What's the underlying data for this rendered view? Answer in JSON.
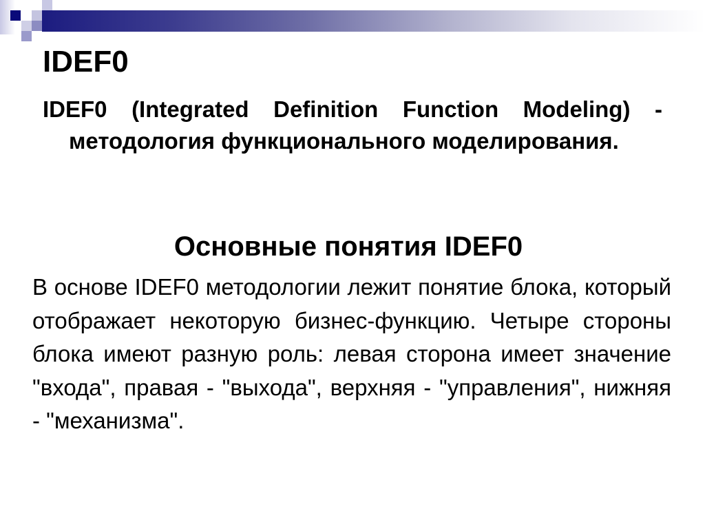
{
  "slide": {
    "title": "IDEF0",
    "definition": "IDEF0 (Integrated Definition Function Modeling) - методология функционального моделирования.",
    "section_heading": "Основные понятия IDEF0",
    "body": "В основе IDEF0 методологии лежит понятие блока, который отображает некоторую бизнес-функцию. Четыре стороны блока имеют разную роль: левая сторона имеет значение \"входа\", правая - \"выхода\", верхняя - \"управления\", нижняя - \"механизма\"."
  },
  "theme": {
    "accent_dark": "#1c1c80",
    "accent_medium": "#8e8ec4",
    "accent_light": "#c8c8e4",
    "text_color": "#000000",
    "background": "#ffffff"
  }
}
